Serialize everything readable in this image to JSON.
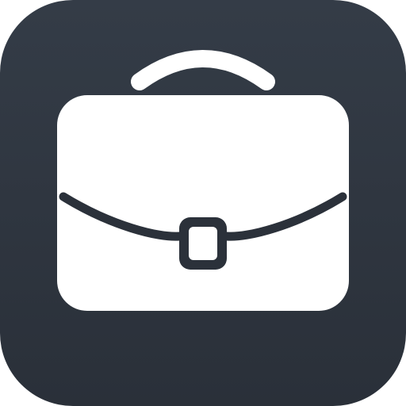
{
  "app_icon": {
    "icon": "briefcase-icon",
    "colors": {
      "background_top": "#343c47",
      "background_bottom": "#2a3039",
      "glyph": "#ffffff",
      "glyph_detail": "#2b313a"
    }
  }
}
